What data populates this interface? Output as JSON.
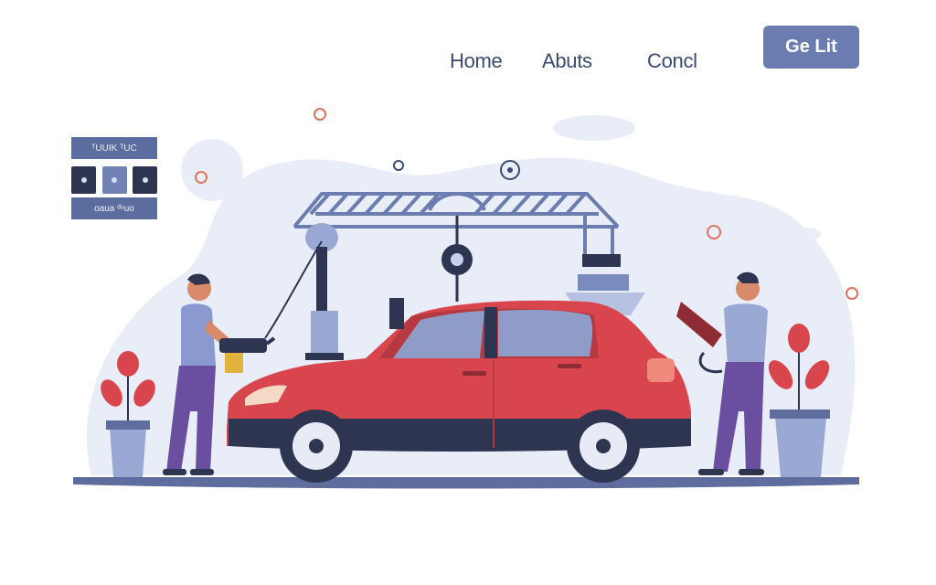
{
  "nav": {
    "home": "Home",
    "about": "Abuts",
    "contact": "Concl"
  },
  "cta": {
    "label": "Ge Lit"
  },
  "panel": {
    "top_label": "ᵀUUIK ᵀUC",
    "bottom_label": "oaua ᵈᵘuo"
  },
  "colors": {
    "accent": "#6b7db0",
    "car_red": "#d9454d",
    "navy": "#2e3550",
    "backdrop": "#e9edf8"
  }
}
